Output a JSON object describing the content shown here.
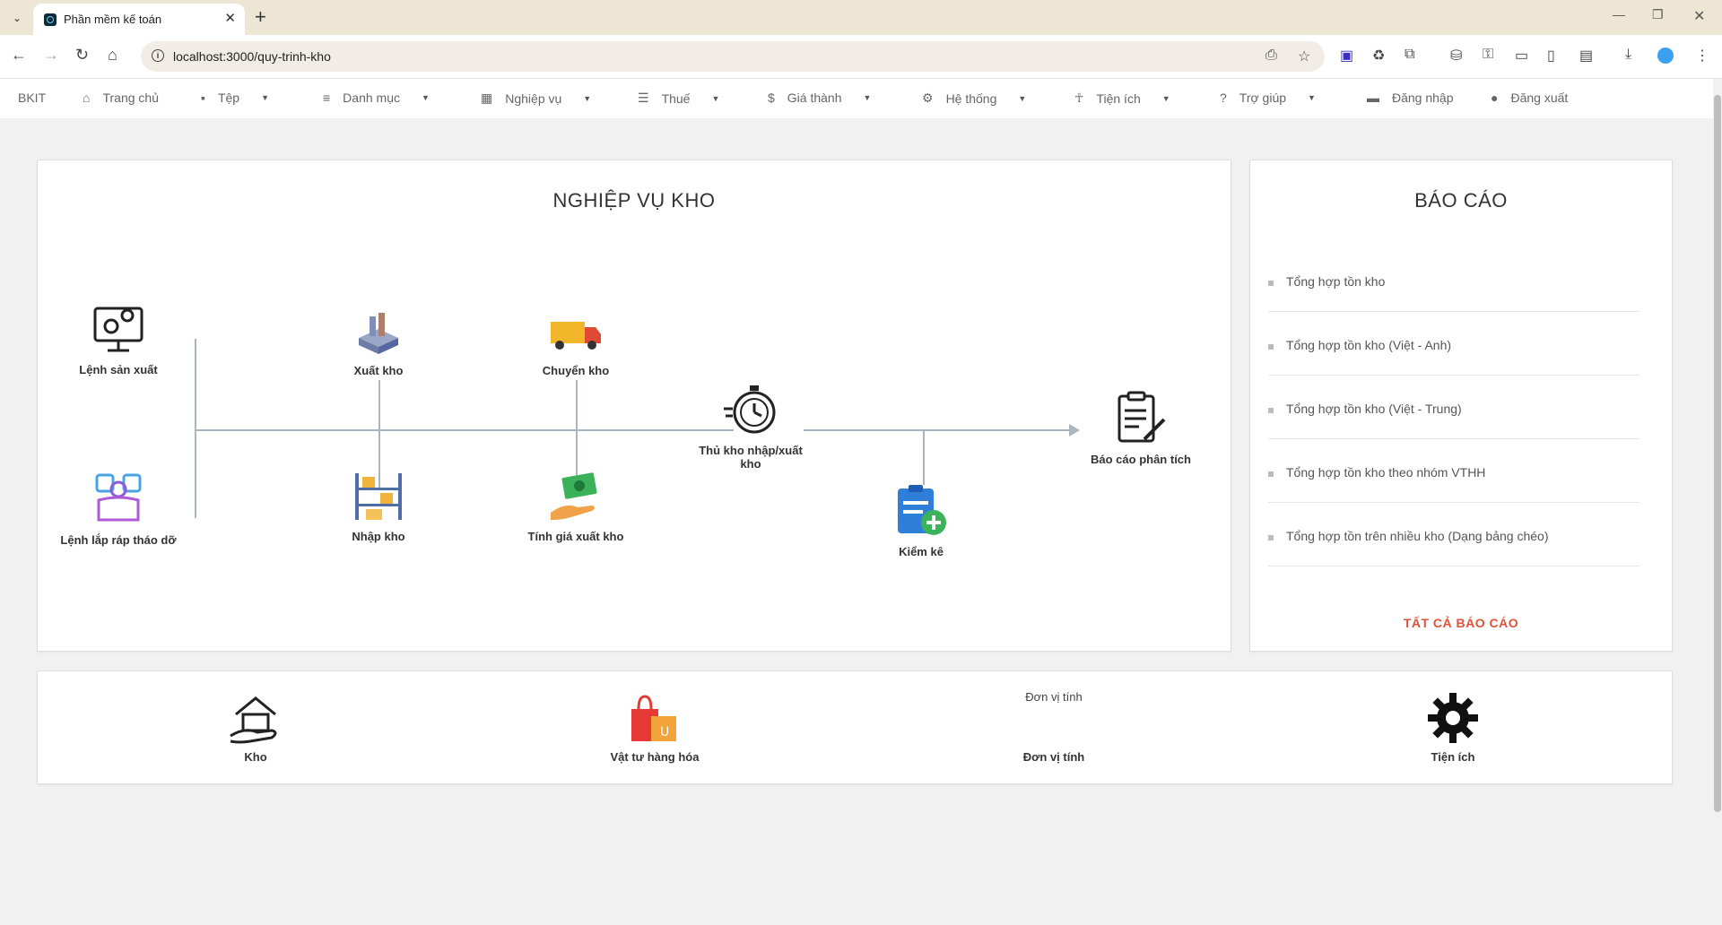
{
  "browser": {
    "tab_title": "Phần mềm kế toán",
    "url": "localhost:3000/quy-trinh-kho",
    "new_tab_icon": "plus-icon",
    "accent": "#eee6d4"
  },
  "nav": {
    "brand": "BKIT",
    "items": [
      {
        "label": "Trang chủ",
        "icon": "home-icon"
      },
      {
        "label": "Tệp",
        "icon": "save-icon"
      },
      {
        "label": "Danh mục",
        "icon": "list-icon"
      },
      {
        "label": "Nghiệp vụ",
        "icon": "ledger-icon"
      },
      {
        "label": "Thuế",
        "icon": "checklist-icon"
      },
      {
        "label": "Giá thành",
        "icon": "dollar-icon"
      },
      {
        "label": "Hệ thống",
        "icon": "gear-icon"
      },
      {
        "label": "Tiện ích",
        "icon": "walk-icon"
      },
      {
        "label": "Trợ giúp",
        "icon": "help-icon"
      },
      {
        "label": "Đăng nhập",
        "icon": "login-icon"
      },
      {
        "label": "Đăng xuất",
        "icon": "logout-icon"
      }
    ]
  },
  "workflow": {
    "title": "NGHIỆP VỤ KHO",
    "nodes": {
      "production_order": "Lệnh sản xuất",
      "assembly_order": "Lệnh lắp ráp tháo dỡ",
      "export": "Xuất kho",
      "import": "Nhập kho",
      "transfer": "Chuyển kho",
      "pricing": "Tính giá xuất kho",
      "keeper": "Thủ kho nhập/xuất kho",
      "inventory_check": "Kiểm kê",
      "analysis": "Báo cáo phân tích"
    }
  },
  "reports": {
    "title": "BÁO CÁO",
    "items": [
      "Tổng hợp tồn kho",
      "Tổng hợp tồn kho (Việt - Anh)",
      "Tổng hợp tồn kho (Việt - Trung)",
      "Tổng hợp tồn kho theo nhóm VTHH",
      "Tổng hợp tồn trên nhiều kho (Dạng bảng chéo)"
    ],
    "all_label": "TẤT CẢ BÁO CÁO",
    "all_color": "#e0513a"
  },
  "quick": {
    "items": [
      {
        "label": "Kho",
        "icon": "warehouse-hand-icon"
      },
      {
        "label": "Vật tư hàng hóa",
        "icon": "shopping-bag-icon"
      },
      {
        "label": "Đơn vị tính",
        "icon": "broken-image-icon",
        "alt": "Đơn vị tính"
      },
      {
        "label": "Tiện ích",
        "icon": "gear-icon"
      }
    ]
  }
}
